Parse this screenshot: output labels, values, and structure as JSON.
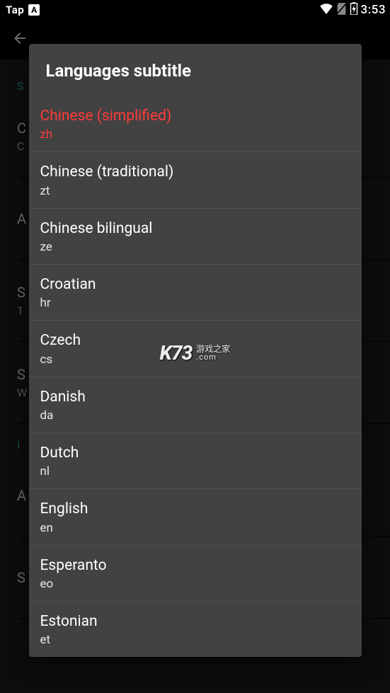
{
  "status_bar": {
    "tap": "Tap",
    "a_badge": "A",
    "clock": "3:53"
  },
  "background": {
    "title": "",
    "section1": "S",
    "items": [
      {
        "primary": "C",
        "secondary": "C"
      },
      {
        "primary": "A",
        "secondary": ""
      },
      {
        "primary": "S",
        "secondary": "1"
      },
      {
        "primary": "S",
        "secondary": "W"
      }
    ],
    "section2": "I",
    "items2": [
      {
        "primary": "A",
        "secondary": ""
      },
      {
        "primary": "S",
        "secondary": ""
      }
    ]
  },
  "dialog": {
    "title": "Languages subtitle",
    "languages": [
      {
        "name": "Chinese (simplified)",
        "code": "zh",
        "selected": true
      },
      {
        "name": "Chinese (traditional)",
        "code": "zt",
        "selected": false
      },
      {
        "name": "Chinese bilingual",
        "code": "ze",
        "selected": false
      },
      {
        "name": "Croatian",
        "code": "hr",
        "selected": false
      },
      {
        "name": "Czech",
        "code": "cs",
        "selected": false
      },
      {
        "name": "Danish",
        "code": "da",
        "selected": false
      },
      {
        "name": "Dutch",
        "code": "nl",
        "selected": false
      },
      {
        "name": "English",
        "code": "en",
        "selected": false
      },
      {
        "name": "Esperanto",
        "code": "eo",
        "selected": false
      },
      {
        "name": "Estonian",
        "code": "et",
        "selected": false
      }
    ]
  },
  "watermark": {
    "brand": "K73",
    "line1": "游戏之家",
    "line2": ".com"
  }
}
